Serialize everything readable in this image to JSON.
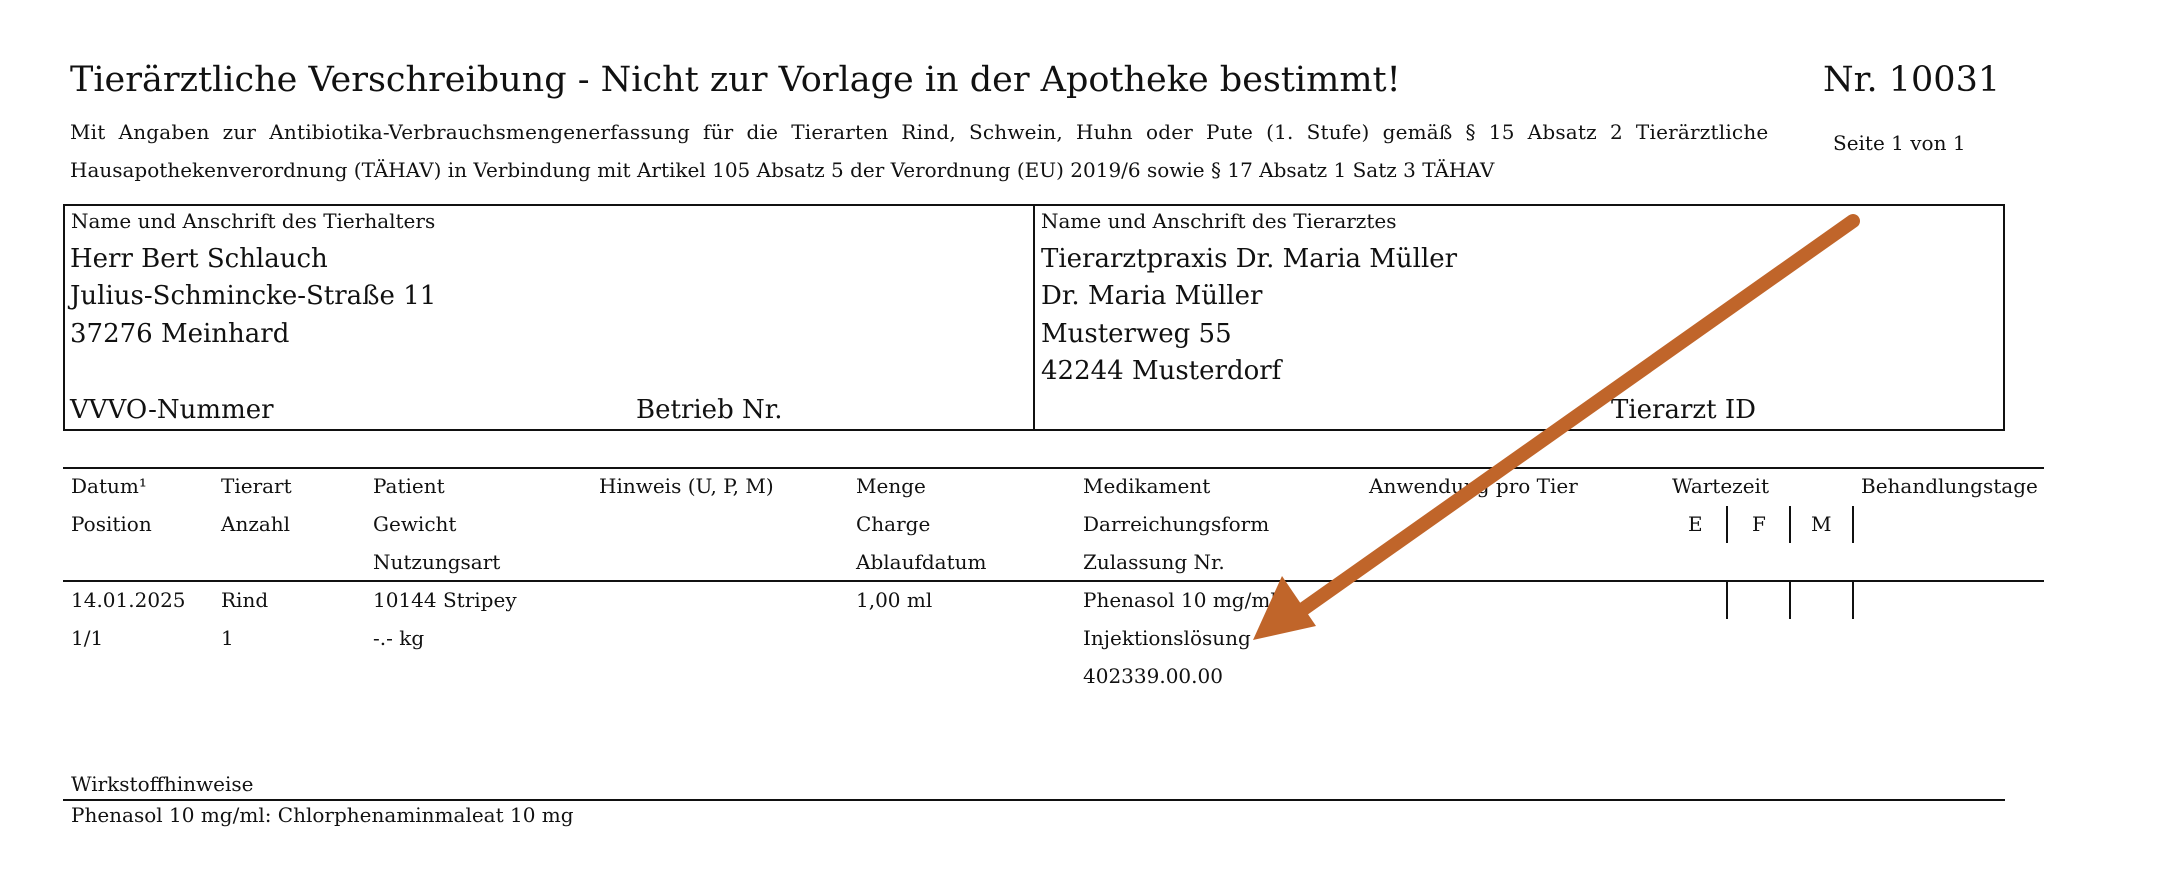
{
  "header": {
    "title": "Tierärztliche Verschreibung - Nicht zur Vorlage in der Apotheke bestimmt!",
    "number": "Nr. 10031",
    "subtitle_line1": "Mit Angaben zur Antibiotika-Verbrauchsmengenerfassung für die Tierarten Rind, Schwein, Huhn oder Pute (1. Stufe) gemäß § 15 Absatz 2 Tierärztliche",
    "subtitle_line2": "Hausapothekenverordnung (TÄHAV) in Verbindung mit Artikel 105 Absatz 5 der Verordnung (EU) 2019/6 sowie § 17 Absatz 1 Satz 3 TÄHAV",
    "page_info": "Seite 1 von 1"
  },
  "owner": {
    "heading": "Name und Anschrift des Tierhalters",
    "name": "Herr Bert Schlauch",
    "street": "Julius-Schmincke-Straße 11",
    "city": "37276 Meinhard",
    "vvvo_label": "VVVO-Nummer",
    "betrieb_label": "Betrieb Nr."
  },
  "vet": {
    "heading": "Name und Anschrift des Tierarztes",
    "practice": "Tierarztpraxis Dr. Maria Müller",
    "name": "Dr. Maria Müller",
    "street": "Musterweg 55",
    "city": "42244 Musterdorf",
    "id_label": "Tierarzt ID"
  },
  "table": {
    "headers_row1": {
      "datum": "Datum¹",
      "tierart": "Tierart",
      "patient": "Patient",
      "hinweis": "Hinweis (U, P, M)",
      "menge": "Menge",
      "medikament": "Medikament",
      "anwendung": "Anwendung pro Tier",
      "wartezeit": "Wartezeit",
      "behandlungstage": "Behandlungstage"
    },
    "headers_row2": {
      "position": "Position",
      "anzahl": "Anzahl",
      "gewicht": "Gewicht",
      "charge": "Charge",
      "darreichungsform": "Darreichungsform",
      "e": "E",
      "f": "F",
      "m": "M"
    },
    "headers_row3": {
      "nutzungsart": "Nutzungsart",
      "ablaufdatum": "Ablaufdatum",
      "zulassung": "Zulassung Nr."
    },
    "row": {
      "datum": "14.01.2025",
      "position": "1/1",
      "tierart": "Rind",
      "anzahl": "1",
      "patient": "10144 Stripey",
      "gewicht": "-.- kg",
      "menge": "1,00 ml",
      "medikament": "Phenasol 10 mg/ml",
      "darreichungsform": "Injektionslösung",
      "zulassung": "402339.00.00"
    }
  },
  "wirkstoff": {
    "heading": "Wirkstoffhinweise",
    "text": "Phenasol 10 mg/ml: Chlorphenaminmaleat 10 mg"
  },
  "colors": {
    "arrow": "#c0652a",
    "ink": "#111111"
  }
}
